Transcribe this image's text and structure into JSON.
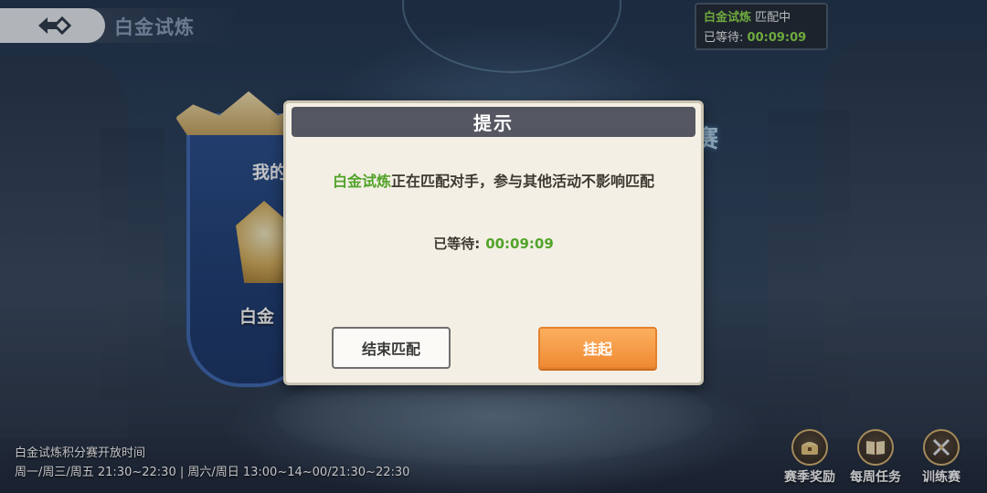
{
  "header": {
    "back_icon": "back-arrow-icon",
    "title": "白金试炼"
  },
  "match_status": {
    "mode": "白金试炼",
    "state": "匹配中",
    "wait_label": "已等待:",
    "wait_time": "00:09:09"
  },
  "shield": {
    "label_mine": "我的",
    "label_tier": "白金",
    "emblem_icon": "rank-emblem-icon"
  },
  "modal": {
    "title": "提示",
    "message_highlight": "白金试炼",
    "message_rest": "正在匹配对手，参与其他活动不影响匹配",
    "wait_label": "已等待:",
    "wait_time": "00:09:09",
    "end_button": "结束匹配",
    "hang_button": "挂起"
  },
  "schedule": {
    "title": "白金试炼积分赛开放时间",
    "times": "周一/周三/周五 21:30~22:30  |  周六/周日 13:00~14~00/21:30~22:30"
  },
  "bottom_buttons": [
    {
      "label": "赛季奖励",
      "icon": "treasure-chest-icon"
    },
    {
      "label": "每周任务",
      "icon": "book-icon"
    },
    {
      "label": "训练赛",
      "icon": "crossed-swords-icon"
    }
  ],
  "colors": {
    "highlight_green": "#52a32a",
    "status_green": "#8fdc4b",
    "hang_button_orange": "#f08a33",
    "modal_header": "#545761",
    "modal_bg": "#f3efe4"
  }
}
